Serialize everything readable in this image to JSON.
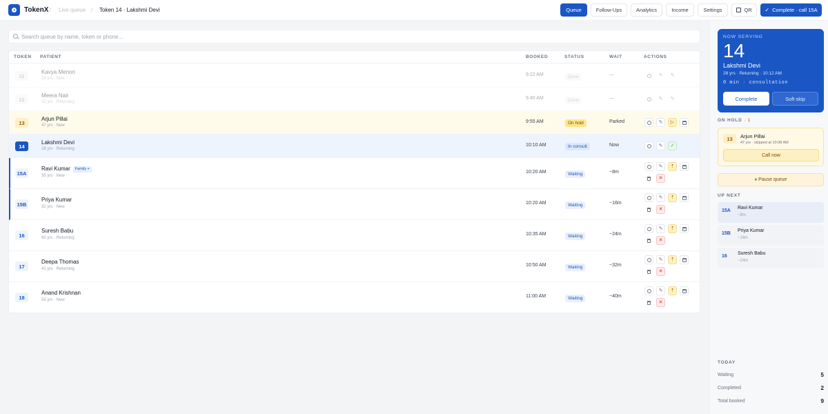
{
  "app": {
    "brand": "TokenX"
  },
  "breadcrumb": {
    "section": "Live queue",
    "current": "Token 14 · Lakshmi Devi"
  },
  "nav": [
    {
      "label": "Queue",
      "active": true
    },
    {
      "label": "Follow-Ups"
    },
    {
      "label": "Analytics"
    },
    {
      "label": "Income"
    },
    {
      "label": "Settings"
    },
    {
      "label": "QR",
      "icon": "qr-icon"
    }
  ],
  "primary_action": {
    "label": "Complete · call 15A"
  },
  "search": {
    "placeholder": "Search queue by name, token or phone…",
    "value": ""
  },
  "table": {
    "headers": {
      "token": "TOKEN",
      "patient": "PATIENT",
      "booked": "BOOKED",
      "status": "STATUS",
      "wait": "WAIT",
      "actions": "ACTIONS"
    },
    "rows": [
      {
        "token": "11",
        "name": "Kavya Menon",
        "meta": "24 yrs · New",
        "booked": "9:22 AM",
        "status": "Done",
        "wait": "—",
        "state": "done"
      },
      {
        "token": "12",
        "name": "Meera Nair",
        "meta": "32 yrs · Returning",
        "booked": "9:40 AM",
        "status": "Done",
        "wait": "—",
        "state": "done"
      },
      {
        "token": "13",
        "name": "Arjun Pillai",
        "meta": "47 yrs · New",
        "booked": "9:55 AM",
        "status": "On hold",
        "wait": "Parked",
        "state": "hold"
      },
      {
        "token": "14",
        "name": "Lakshmi Devi",
        "meta": "28 yrs · Returning",
        "booked": "10:10 AM",
        "status": "In consult",
        "wait": "Now",
        "state": "current"
      },
      {
        "token": "15A",
        "name": "Ravi Kumar",
        "tag": "Family +",
        "meta": "35 yrs · New",
        "booked": "10:20 AM",
        "status": "Waiting",
        "wait": "~8m",
        "state": "waiting"
      },
      {
        "token": "15B",
        "name": "Priya Kumar",
        "meta": "32 yrs · New",
        "booked": "10:20 AM",
        "status": "Waiting",
        "wait": "~16m",
        "state": "waiting"
      },
      {
        "token": "16",
        "name": "Suresh Babu",
        "meta": "60 yrs · Returning",
        "booked": "10:35 AM",
        "status": "Waiting",
        "wait": "~24m",
        "state": "waiting"
      },
      {
        "token": "17",
        "name": "Deepa Thomas",
        "meta": "41 yrs · Returning",
        "booked": "10:50 AM",
        "status": "Waiting",
        "wait": "~32m",
        "state": "waiting"
      },
      {
        "token": "18",
        "name": "Anand Krishnan",
        "meta": "55 yrs · New",
        "booked": "11:00 AM",
        "status": "Waiting",
        "wait": "~40m",
        "state": "waiting"
      }
    ]
  },
  "now_serving": {
    "label": "NOW SERVING",
    "token": "14",
    "name": "Lakshmi Devi",
    "meta": "28 yrs · Returning · 10:12 AM",
    "timer": "0 min · consultation",
    "complete_label": "Complete",
    "skip_label": "Soft skip"
  },
  "on_hold": {
    "title": "ON HOLD",
    "count": "· 1",
    "token": "13",
    "name": "Arjun Pillai",
    "meta": "47 yrs · skipped at 10:08 AM",
    "call_label": "Call now"
  },
  "pause": {
    "label": "Pause queue"
  },
  "up_next": {
    "title": "UP NEXT",
    "items": [
      {
        "token": "15A",
        "name": "Ravi Kumar",
        "wait": "~8m"
      },
      {
        "token": "15B",
        "name": "Priya Kumar",
        "wait": "~16m"
      },
      {
        "token": "16",
        "name": "Suresh Babu",
        "wait": "~24m"
      }
    ]
  },
  "today": {
    "title": "TODAY",
    "stats": [
      {
        "label": "Waiting",
        "value": "5"
      },
      {
        "label": "Completed",
        "value": "2"
      },
      {
        "label": "Total booked",
        "value": "9"
      }
    ]
  },
  "colors": {
    "primary": "#1a56c4",
    "hold": "#fdefc7",
    "danger": "#dc2626",
    "success": "#16a34a"
  }
}
